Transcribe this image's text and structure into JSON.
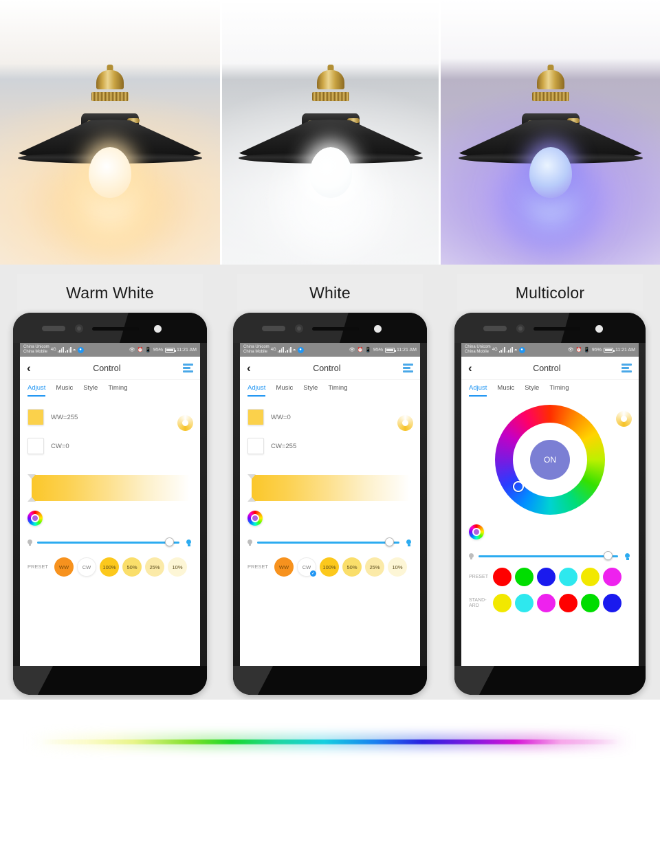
{
  "sections": [
    {
      "label": "Warm White",
      "lamp_variant": "warm",
      "phone": {
        "status": {
          "carrier_line1": "China Unicom",
          "carrier_line2": "China Mobile",
          "network": "4G",
          "battery": "95%",
          "time": "11:21 AM"
        },
        "header": {
          "back": "‹",
          "title": "Control",
          "menu": "menu-icon"
        },
        "tabs": [
          {
            "label": "Adjust",
            "active": true
          },
          {
            "label": "Music",
            "active": false
          },
          {
            "label": "Style",
            "active": false
          },
          {
            "label": "Timing",
            "active": false
          }
        ],
        "channels": [
          {
            "name": "WW",
            "text": "WW=255",
            "swatch": "#fbd14b"
          },
          {
            "name": "CW",
            "text": "CW=0",
            "swatch": "#ffffff"
          }
        ],
        "preset_label": "PRESET",
        "presets": [
          {
            "label": "WW",
            "selected": false
          },
          {
            "label": "CW",
            "selected": false
          },
          {
            "label": "100%",
            "selected": false
          },
          {
            "label": "50%",
            "selected": false
          },
          {
            "label": "25%",
            "selected": false
          },
          {
            "label": "10%",
            "selected": false
          }
        ]
      }
    },
    {
      "label": "White",
      "lamp_variant": "white",
      "phone": {
        "status": {
          "carrier_line1": "China Unicom",
          "carrier_line2": "China Mobile",
          "network": "4G",
          "battery": "95%",
          "time": "11:21 AM"
        },
        "header": {
          "back": "‹",
          "title": "Control",
          "menu": "menu-icon"
        },
        "tabs": [
          {
            "label": "Adjust",
            "active": true
          },
          {
            "label": "Music",
            "active": false
          },
          {
            "label": "Style",
            "active": false
          },
          {
            "label": "Timing",
            "active": false
          }
        ],
        "channels": [
          {
            "name": "WW",
            "text": "WW=0",
            "swatch": "#fbd14b"
          },
          {
            "name": "CW",
            "text": "CW=255",
            "swatch": "#ffffff"
          }
        ],
        "preset_label": "PRESET",
        "presets": [
          {
            "label": "WW",
            "selected": false
          },
          {
            "label": "CW",
            "selected": true
          },
          {
            "label": "100%",
            "selected": false
          },
          {
            "label": "50%",
            "selected": false
          },
          {
            "label": "25%",
            "selected": false
          },
          {
            "label": "10%",
            "selected": false
          }
        ]
      }
    },
    {
      "label": "Multicolor",
      "lamp_variant": "multi",
      "phone": {
        "status": {
          "carrier_line1": "China Unicom",
          "carrier_line2": "China Mobile",
          "network": "4G",
          "battery": "95%",
          "time": "11:21 AM"
        },
        "header": {
          "back": "‹",
          "title": "Control",
          "menu": "menu-icon"
        },
        "tabs": [
          {
            "label": "Adjust",
            "active": true
          },
          {
            "label": "Music",
            "active": false
          },
          {
            "label": "Style",
            "active": false
          },
          {
            "label": "Timing",
            "active": false
          }
        ],
        "power_button": "ON",
        "preset_label": "PRESET",
        "standard_label": "STAND-\nARD",
        "preset_colors": [
          "#ff0000",
          "#00dd00",
          "#1a1aee",
          "#2ee8ee",
          "#f2e800",
          "#ee22ee"
        ],
        "standard_colors": [
          "#f2e800",
          "#2ee8ee",
          "#ee22ee",
          "#ff0000",
          "#00dd00",
          "#1a1aee"
        ]
      }
    }
  ],
  "accent": {
    "blue": "#2196f3",
    "slider_blue": "#2cabf0",
    "warm_yellow": "#fbd14b",
    "on_button": "#7b7fd4"
  }
}
